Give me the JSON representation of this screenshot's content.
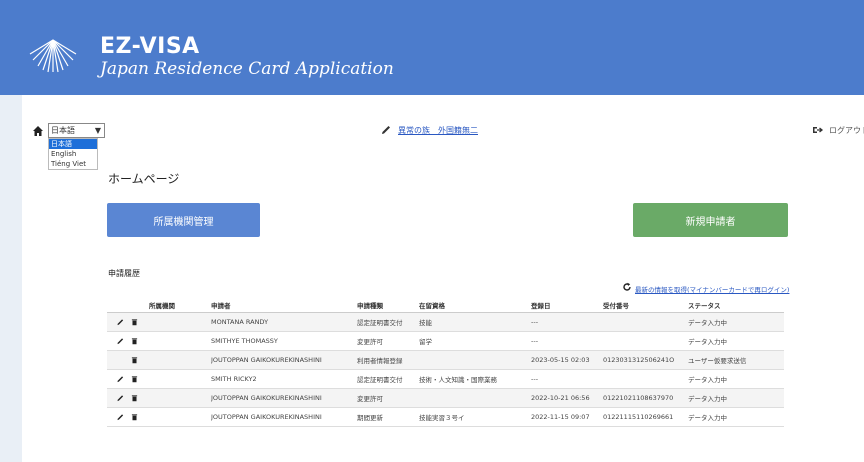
{
  "brand": {
    "title": "EZ-VISA",
    "subtitle": "Japan Residence Card Application"
  },
  "language": {
    "selected": "日本語",
    "options": [
      "日本語",
      "English",
      "Tiéng Viet"
    ]
  },
  "user": {
    "name": "異常の族　外国籍無二"
  },
  "logout": {
    "label": "ログアウト"
  },
  "page": {
    "title": "ホームページ"
  },
  "buttons": {
    "affiliation": "所属機関管理",
    "new_applicant": "新規申請者"
  },
  "history": {
    "title": "申請履歴",
    "refresh_link": "最新の情報を取得(マイナンバーカードで再ログイン)",
    "columns": [
      "",
      "所属機関",
      "申請者",
      "申請種類",
      "在留資格",
      "登録日",
      "受付番号",
      "ステータス"
    ],
    "rows": [
      {
        "edit": true,
        "applicant": "MONTANA RANDY",
        "type": "認定証明書交付",
        "status_of_residence": "技能",
        "date": "---",
        "receipt": "",
        "status": "データ入力中"
      },
      {
        "edit": true,
        "applicant": "SMITHYE THOMASSY",
        "type": "変更許可",
        "status_of_residence": "留学",
        "date": "---",
        "receipt": "",
        "status": "データ入力中"
      },
      {
        "edit": false,
        "applicant": "JOUTOPPAN GAIKOKUREKINASHINI",
        "type": "利用者情報登録",
        "status_of_residence": "",
        "date": "2023-05-15 02:03",
        "receipt": "0123031312506241O",
        "status": "ユーザー仮要求送信"
      },
      {
        "edit": true,
        "applicant": "SMITH RICKY2",
        "type": "認定証明書交付",
        "status_of_residence": "技術・人文知識・国際業務",
        "date": "---",
        "receipt": "",
        "status": "データ入力中"
      },
      {
        "edit": true,
        "applicant": "JOUTOPPAN GAIKOKUREKINASHINI",
        "type": "変更許可",
        "status_of_residence": "",
        "date": "2022-10-21 06:56",
        "receipt": "01221021108637970",
        "status": "データ入力中"
      },
      {
        "edit": true,
        "applicant": "JOUTOPPAN GAIKOKUREKINASHINI",
        "type": "期間更新",
        "status_of_residence": "技能実習３号イ",
        "date": "2022-11-15 09:07",
        "receipt": "01221115110269661",
        "status": "データ入力中"
      }
    ]
  },
  "colors": {
    "header": "#4c7ccc",
    "primary_button": "#5a86d3",
    "success_button": "#6aaa67",
    "link": "#2a58c2"
  }
}
